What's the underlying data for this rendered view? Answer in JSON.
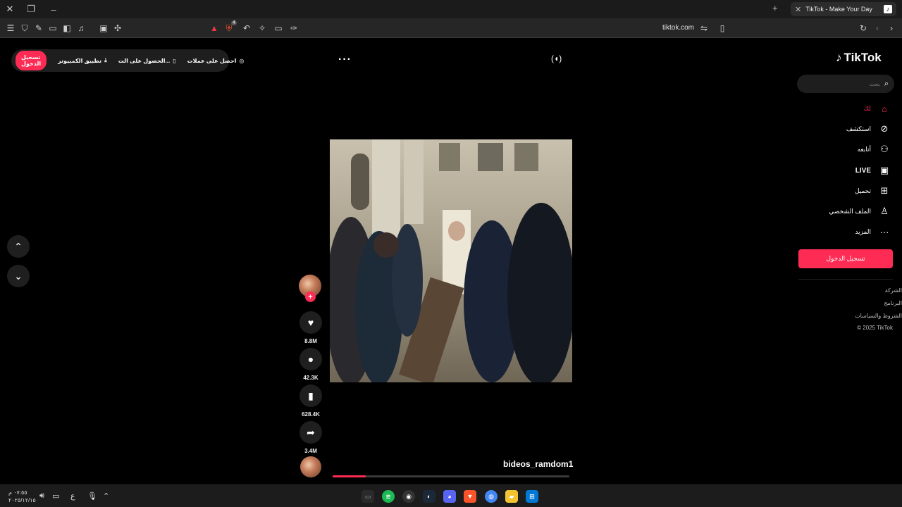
{
  "browser": {
    "tab_title": "TikTok - Make Your Day",
    "new_tab_icon": "plus-icon",
    "url": "tiktok.com",
    "brave_badge_count": "4"
  },
  "topbar": {
    "login_label": "تسجيل الدخول",
    "desktop_app_label": "تطبيق الكمبيوتر",
    "get_app_label": "الحصول على الت...",
    "coins_label": "احصل على عملات"
  },
  "sidebar": {
    "logo_text": "TikTok",
    "search_placeholder": "بحث",
    "items": [
      {
        "label": "لك",
        "icon": "home-icon"
      },
      {
        "label": "استكشف",
        "icon": "compass-icon"
      },
      {
        "label": "أتابعه",
        "icon": "user-follow-icon"
      },
      {
        "label": "LIVE",
        "icon": "live-tv-icon"
      },
      {
        "label": "تحميل",
        "icon": "upload-plus-icon"
      },
      {
        "label": "الملف الشخصي",
        "icon": "profile-icon"
      },
      {
        "label": "المزيد",
        "icon": "more-dots-icon"
      }
    ],
    "login_button": "تسجيل الدخول",
    "footer": [
      "الشركة",
      "البرنامج",
      "الشروط والسياسات",
      "© 2025 TikTok"
    ]
  },
  "video": {
    "username": "bideos_ramdom1",
    "progress": 0.14,
    "likes": "8.8M",
    "comments": "42.3K",
    "saves": "628.4K",
    "shares": "3.4M"
  },
  "taskbar": {
    "time": "٠٧:٥٥ م",
    "date": "٢٠٢٥/١٢/١٥",
    "lang": "ع"
  },
  "colors": {
    "accent": "#fe2c55",
    "background": "#000000"
  }
}
